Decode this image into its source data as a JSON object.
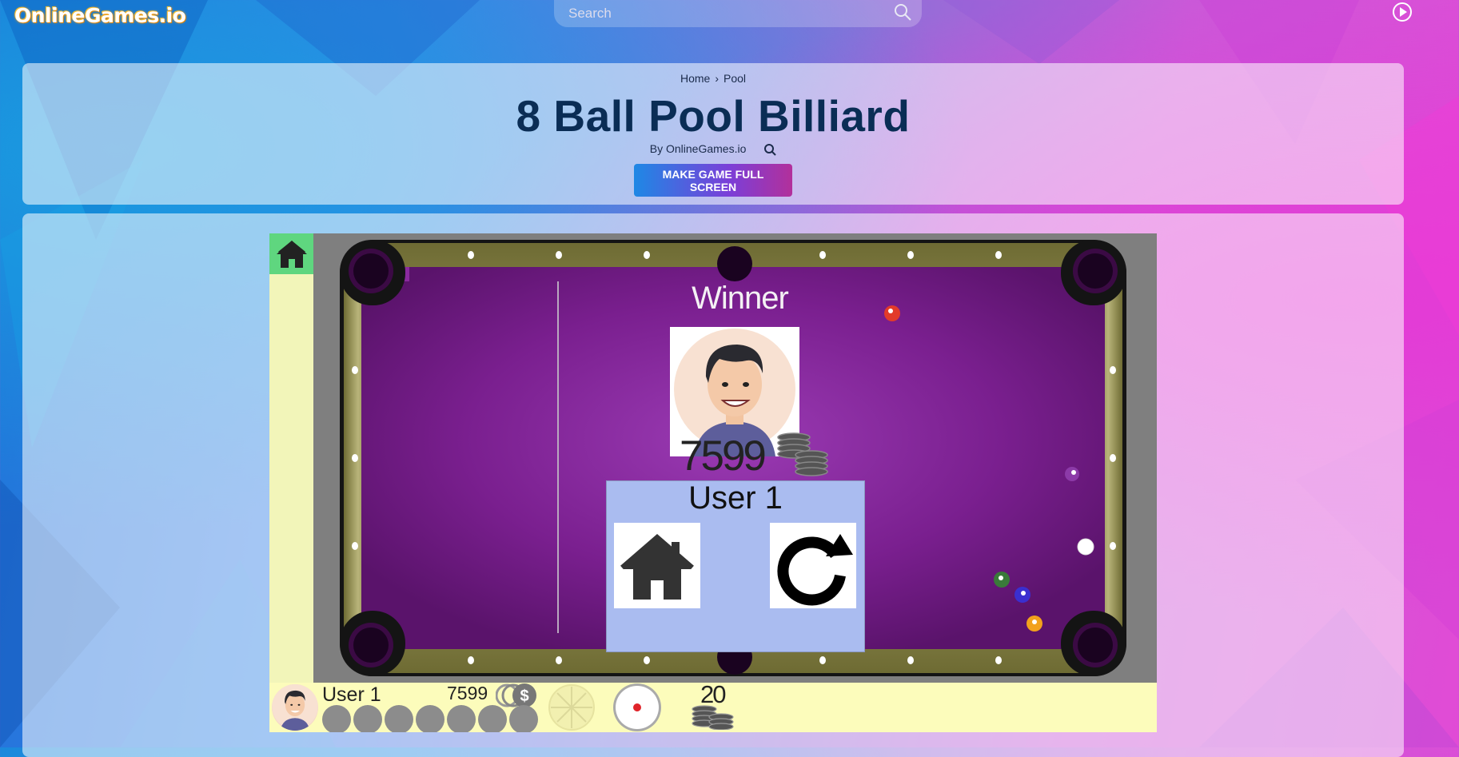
{
  "site": {
    "logo_text": "OnlineGames.io"
  },
  "search": {
    "placeholder": "Search"
  },
  "header": {
    "breadcrumb": [
      "Home",
      "Pool"
    ],
    "breadcrumb_separator": "›",
    "title": "8 Ball Pool Billiard",
    "byline": "By OnlineGames.io",
    "fullscreen_button": "MAKE GAME FULL SCREEN"
  },
  "game": {
    "winner_label": "Winner",
    "winner_coins": "7599",
    "result_user": "User 1",
    "player": {
      "name": "User 1",
      "coins": "7599",
      "balls_remaining": 7
    },
    "bet": "20",
    "colors": {
      "felt": "#7a1f8f",
      "rail": "#8c8a4a",
      "strip": "#fcfcbb",
      "home_corner": "#5fd67f"
    }
  }
}
